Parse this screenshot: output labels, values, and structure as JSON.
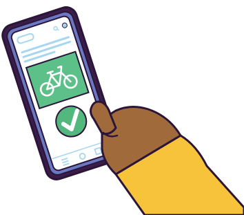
{
  "illustration": {
    "subject": "hand-tapping-smartphone",
    "icons": [
      "menu-pill-icon",
      "search-icon",
      "status-dot-icon",
      "bicycle-icon",
      "checkmark-icon",
      "home-icon",
      "back-icon",
      "square-icon"
    ]
  },
  "colors": {
    "outline": "#2b1538",
    "phone_body": "#3a1d4a",
    "phone_bezel": "#6b78c2",
    "screen": "#ffffff",
    "hero_green": "#5cc088",
    "check_green": "#52b87e",
    "icon_stroke": "#ffffff",
    "ui_light_blue": "#a7d6ef",
    "skin": "#a06a3a",
    "sleeve": "#f6c33b"
  },
  "screen": {
    "text_lines_count": 3,
    "hero_icon": "bicycle-icon",
    "status_icon": "checkmark-icon",
    "nav_icons": [
      "back-icon",
      "home-icon",
      "square-icon"
    ]
  }
}
